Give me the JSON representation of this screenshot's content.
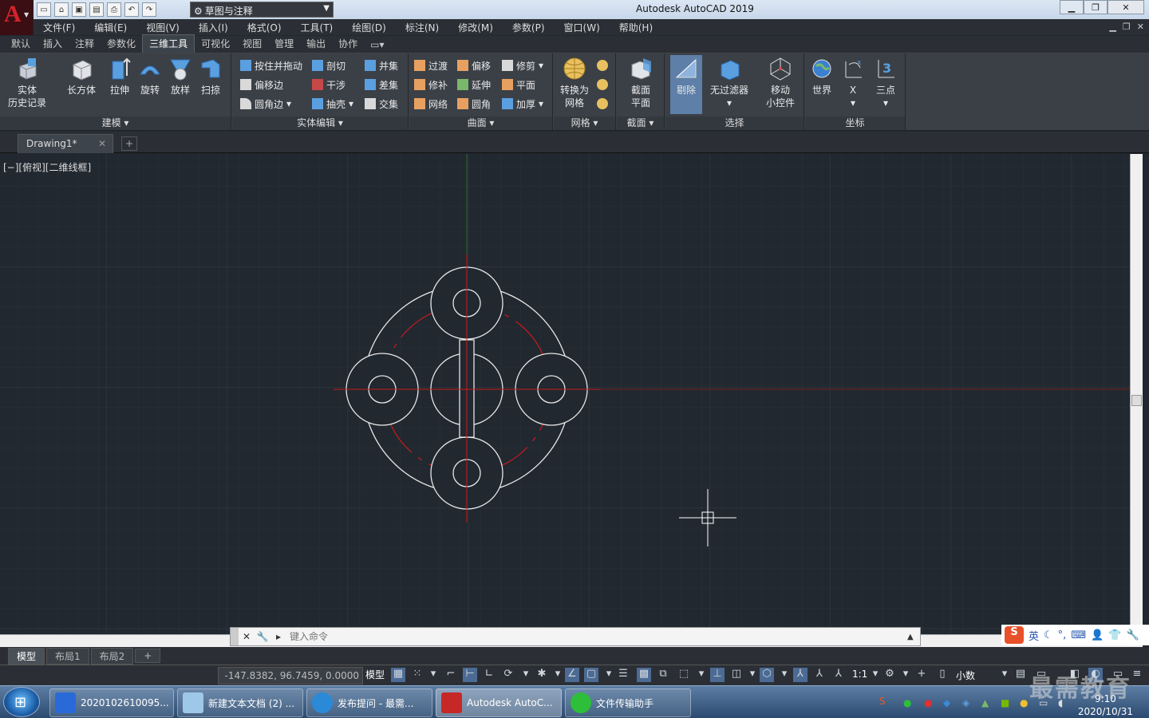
{
  "app": {
    "title": "Autodesk AutoCAD 2019",
    "logo_letter": "A"
  },
  "workspace": {
    "label": "草图与注释"
  },
  "menus": [
    "文件(F)",
    "编辑(E)",
    "视图(V)",
    "插入(I)",
    "格式(O)",
    "工具(T)",
    "绘图(D)",
    "标注(N)",
    "修改(M)",
    "参数(P)",
    "窗口(W)",
    "帮助(H)"
  ],
  "ribbon_tabs": [
    "默认",
    "插入",
    "注释",
    "参数化",
    "三维工具",
    "可视化",
    "视图",
    "管理",
    "输出",
    "协作"
  ],
  "ribbon": {
    "modeling": {
      "title": "建模 ▾",
      "history": [
        "实体",
        "历史记录"
      ],
      "box": "长方体",
      "extrude": "拉伸",
      "revolve": "旋转",
      "loft": "放样",
      "sweep": "扫掠"
    },
    "solid_edit": {
      "title": "实体编辑 ▾",
      "presspull": "按住并拖动",
      "offset_edge": "偏移边",
      "fillet_edge": "圆角边",
      "slice": "剖切",
      "interfere": "干涉",
      "shell": "抽壳",
      "union": "并集",
      "subtract": "差集",
      "intersect": "交集"
    },
    "surface": {
      "title": "曲面 ▾",
      "blend": "过渡",
      "patch": "修补",
      "network": "网络",
      "offset": "偏移",
      "extend": "延伸",
      "fillet": "圆角",
      "trim": "修剪",
      "planar": "平面",
      "thicken": "加厚"
    },
    "mesh": {
      "title": "网格 ▾",
      "convert": [
        "转换为",
        "网格"
      ]
    },
    "section": {
      "title": "截面 ▾",
      "plane": [
        "截面",
        "平面"
      ]
    },
    "selection": {
      "title": "选择",
      "cull": "剔除",
      "nofilter": "无过滤器",
      "gizmo": [
        "移动",
        "小控件"
      ]
    },
    "coords": {
      "title": "坐标",
      "world": "世界",
      "x": "X",
      "three_point": "三点"
    }
  },
  "document_tab": {
    "name": "Drawing1*"
  },
  "viewport": {
    "label": "[−][俯视][二维线框]"
  },
  "command": {
    "placeholder": "键入命令"
  },
  "layout_tabs": [
    "模型",
    "布局1",
    "布局2"
  ],
  "status": {
    "coords": "-147.8382, 96.7459, 0.0000",
    "model": "模型",
    "scale": "1:1",
    "units": "小数"
  },
  "ime": {
    "lang": "英"
  },
  "taskbar": {
    "buttons": [
      "2020102610095...",
      "新建文本文档 (2) ...",
      "发布提问 - 最需...",
      "Autodesk AutoC...",
      "文件传输助手"
    ],
    "time": "9:10",
    "date": "2020/10/31"
  },
  "watermark": "最需教育",
  "colors": {
    "accent_red": "#d4232b",
    "grid_bg": "#212830",
    "drawing_white": "#ffffff",
    "center_red": "#cc1a1a",
    "selected": "#5d7fa8"
  }
}
